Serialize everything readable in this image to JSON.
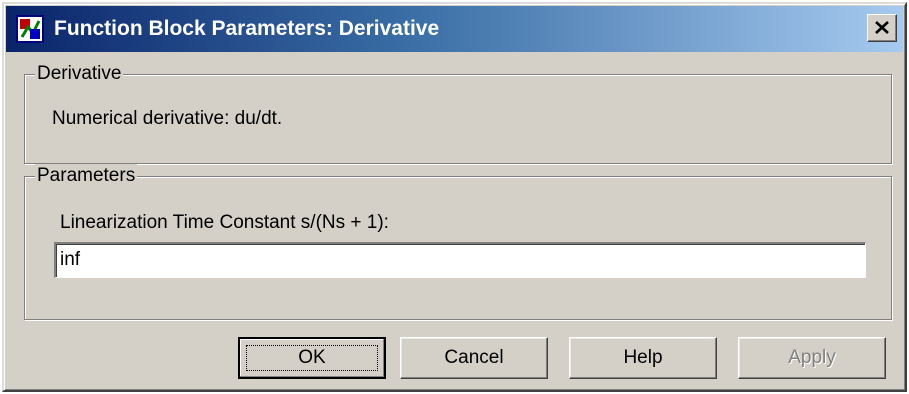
{
  "window": {
    "title": "Function Block Parameters: Derivative",
    "app_icon": "simulink-block-icon",
    "close_icon": "close-x-icon"
  },
  "block_group": {
    "legend": "Derivative",
    "description": "Numerical derivative:  du/dt."
  },
  "parameters_group": {
    "legend": "Parameters",
    "field_label": "Linearization Time Constant s/(Ns + 1):",
    "field_value": "inf"
  },
  "buttons": {
    "ok": "OK",
    "cancel": "Cancel",
    "help": "Help",
    "apply": "Apply"
  },
  "colors": {
    "titlebar_start": "#0a246a",
    "titlebar_end": "#a6caf0",
    "face": "#d4d0c8"
  }
}
